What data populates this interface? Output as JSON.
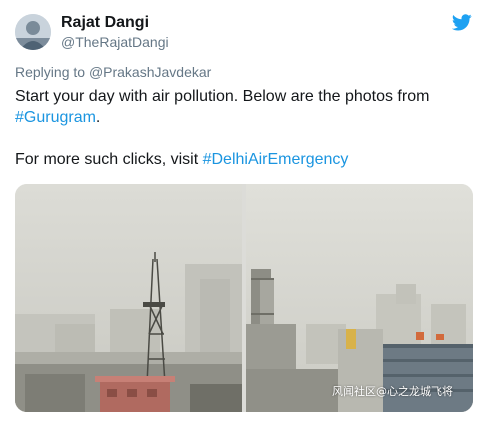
{
  "author": {
    "name": "Rajat Dangi",
    "handle": "@TheRajatDangi"
  },
  "reply": {
    "prefix": "Replying to ",
    "to": "@PrakashJavdekar"
  },
  "tweet": {
    "line1_text": "Start your day with air pollution. Below are the photos from",
    "hashtag1": "#Gurugram",
    "line2_suffix": ".",
    "line3_text": "For more such clicks, visit ",
    "hashtag2": "#DelhiAirEmergency"
  },
  "watermark": "风闻社区@心之龙城飞将",
  "colors": {
    "link": "#1b95e0",
    "twitter_blue": "#1da1f2",
    "muted": "#657786"
  },
  "icons": {
    "brand": "twitter-bird-icon"
  }
}
